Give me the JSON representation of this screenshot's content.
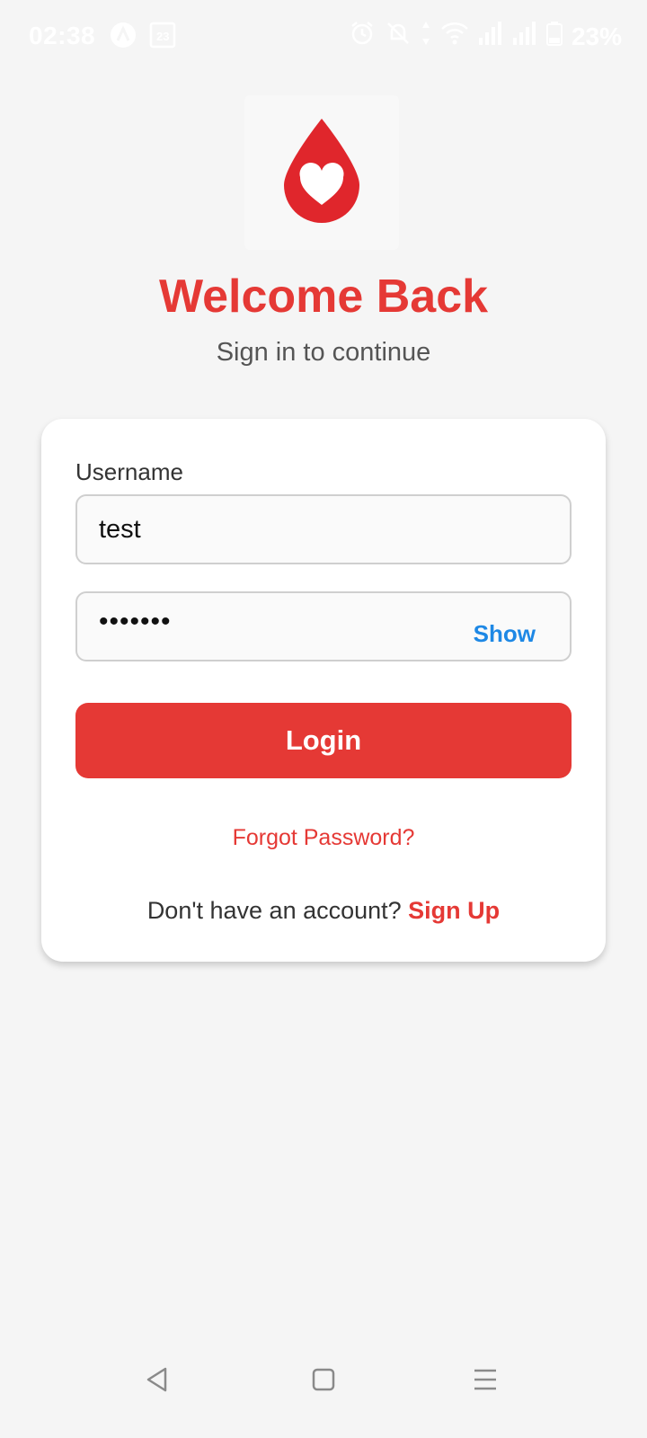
{
  "status_bar": {
    "time": "02:38",
    "battery": "23%",
    "icons": [
      "app-a-icon",
      "notification-box-icon",
      "alarm-icon",
      "mute-icon",
      "data-arrows-icon",
      "wifi-icon",
      "signal-icon",
      "signal-icon",
      "battery-icon"
    ]
  },
  "header": {
    "logo": "blood-drop-heart-icon",
    "title": "Welcome Back",
    "subtitle": "Sign in to continue"
  },
  "form": {
    "username_label": "Username",
    "username_value": "test",
    "password_value": "•••••••",
    "show_label": "Show",
    "login_label": "Login",
    "forgot_label": "Forgot Password?",
    "signup_prompt": "Don't have an account? ",
    "signup_label": "Sign Up"
  },
  "nav_bar": {
    "icons": [
      "back-icon",
      "home-icon",
      "recents-icon"
    ]
  },
  "colors": {
    "accent": "#e53935",
    "link_blue": "#1e88e5",
    "background": "#f5f5f5"
  }
}
